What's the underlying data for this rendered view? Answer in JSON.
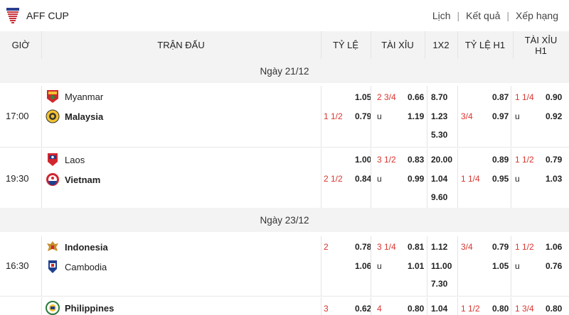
{
  "header": {
    "league": "AFF CUP",
    "nav": [
      "Lịch",
      "Kết quả",
      "Xếp hạng"
    ]
  },
  "columns": {
    "time": "GIỜ",
    "match": "TRẬN ĐẤU",
    "handicap": "TỶ LỆ",
    "over_under": "TÀI XỈU",
    "x12": "1X2",
    "handicap_h1": "TỶ LỆ H1",
    "over_under_h1_line1": "TÀI XỈU",
    "over_under_h1_line2": "H1"
  },
  "days": [
    {
      "label": "Ngày 21/12"
    },
    {
      "label": "Ngày 23/12"
    }
  ],
  "matches": [
    {
      "time": "17:00",
      "home": "Myanmar",
      "away": "Malaysia",
      "bold_team": "away",
      "hdp_line": "1 1/2",
      "hdp_home": "1.05",
      "hdp_away": "0.79",
      "ou_line": "2 3/4",
      "ou_over": "0.66",
      "ou_u": "u",
      "ou_under": "1.19",
      "x12_1": "8.70",
      "x12_2": "1.23",
      "x12_x": "5.30",
      "h1_line": "3/4",
      "h1_home": "0.87",
      "h1_away": "0.97",
      "ouh1_line": "1 1/4",
      "ouh1_over": "0.90",
      "ouh1_u": "u",
      "ouh1_under": "0.92"
    },
    {
      "time": "19:30",
      "home": "Laos",
      "away": "Vietnam",
      "bold_team": "away",
      "hdp_line": "2 1/2",
      "hdp_home": "1.00",
      "hdp_away": "0.84",
      "ou_line": "3 1/2",
      "ou_over": "0.83",
      "ou_u": "u",
      "ou_under": "0.99",
      "x12_1": "20.00",
      "x12_2": "1.04",
      "x12_x": "9.60",
      "h1_line": "1 1/4",
      "h1_home": "0.89",
      "h1_away": "0.95",
      "ouh1_line": "1 1/2",
      "ouh1_over": "0.79",
      "ouh1_u": "u",
      "ouh1_under": "1.03"
    },
    {
      "time": "16:30",
      "home": "Indonesia",
      "away": "Cambodia",
      "bold_team": "home",
      "hdp_line": "2",
      "hdp_home": "0.78",
      "hdp_away": "1.06",
      "ou_line": "3 1/4",
      "ou_over": "0.81",
      "ou_u": "u",
      "ou_under": "1.01",
      "x12_1": "1.12",
      "x12_2": "11.00",
      "x12_x": "7.30",
      "h1_line": "3/4",
      "h1_home": "0.79",
      "h1_away": "1.05",
      "ouh1_line": "1 1/2",
      "ouh1_over": "1.06",
      "ouh1_u": "u",
      "ouh1_under": "0.76"
    },
    {
      "home": "Philippines",
      "hdp_line": "3",
      "hdp_home": "0.62",
      "ou_line": "4",
      "ou_over": "0.80",
      "x12_1": "1.04",
      "h1_line": "1 1/2",
      "h1_home": "0.80",
      "ouh1_line": "1 3/4",
      "ouh1_over": "0.80"
    }
  ],
  "colors": {
    "accent_red": "#d9352f",
    "header_bg": "#f3f3f3"
  }
}
